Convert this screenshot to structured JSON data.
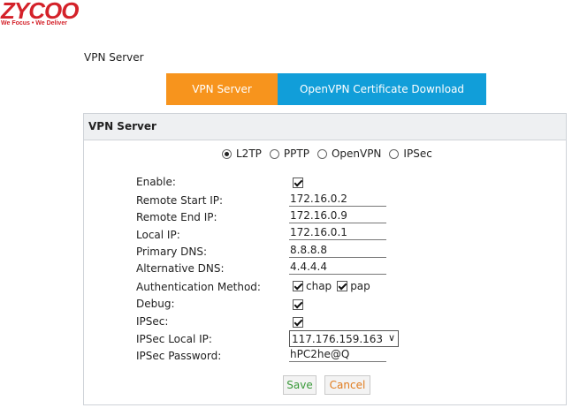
{
  "brand": {
    "logo_text": "ZYCOO",
    "tagline": "We Focus • We Deliver",
    "color": "#d4222a"
  },
  "page_title": "VPN Server",
  "tabs": [
    {
      "label": "VPN Server",
      "active": true,
      "color": "#f7941d"
    },
    {
      "label": "OpenVPN Certificate Download",
      "active": false,
      "color": "#119ed9"
    }
  ],
  "panel": {
    "title": "VPN Server",
    "protocol_options": [
      "L2TP",
      "PPTP",
      "OpenVPN",
      "IPSec"
    ],
    "selected_protocol": "L2TP",
    "fields": {
      "enable": {
        "label": "Enable:",
        "checked": true
      },
      "remote_start_ip": {
        "label": "Remote Start IP:",
        "value": "172.16.0.2"
      },
      "remote_end_ip": {
        "label": "Remote End IP:",
        "value": "172.16.0.9"
      },
      "local_ip": {
        "label": "Local IP:",
        "value": "172.16.0.1"
      },
      "primary_dns": {
        "label": "Primary DNS:",
        "value": "8.8.8.8"
      },
      "alternative_dns": {
        "label": "Alternative DNS:",
        "value": "4.4.4.4"
      },
      "auth_method": {
        "label": "Authentication Method:",
        "chap_label": "chap",
        "chap_checked": true,
        "pap_label": "pap",
        "pap_checked": true
      },
      "debug": {
        "label": "Debug:",
        "checked": true
      },
      "ipsec": {
        "label": "IPSec:",
        "checked": true
      },
      "ipsec_local_ip": {
        "label": "IPSec Local IP:",
        "value": "117.176.159.163"
      },
      "ipsec_password": {
        "label": "IPSec Password:",
        "value": "hPC2he@Q"
      }
    },
    "buttons": {
      "save": "Save",
      "cancel": "Cancel"
    }
  }
}
